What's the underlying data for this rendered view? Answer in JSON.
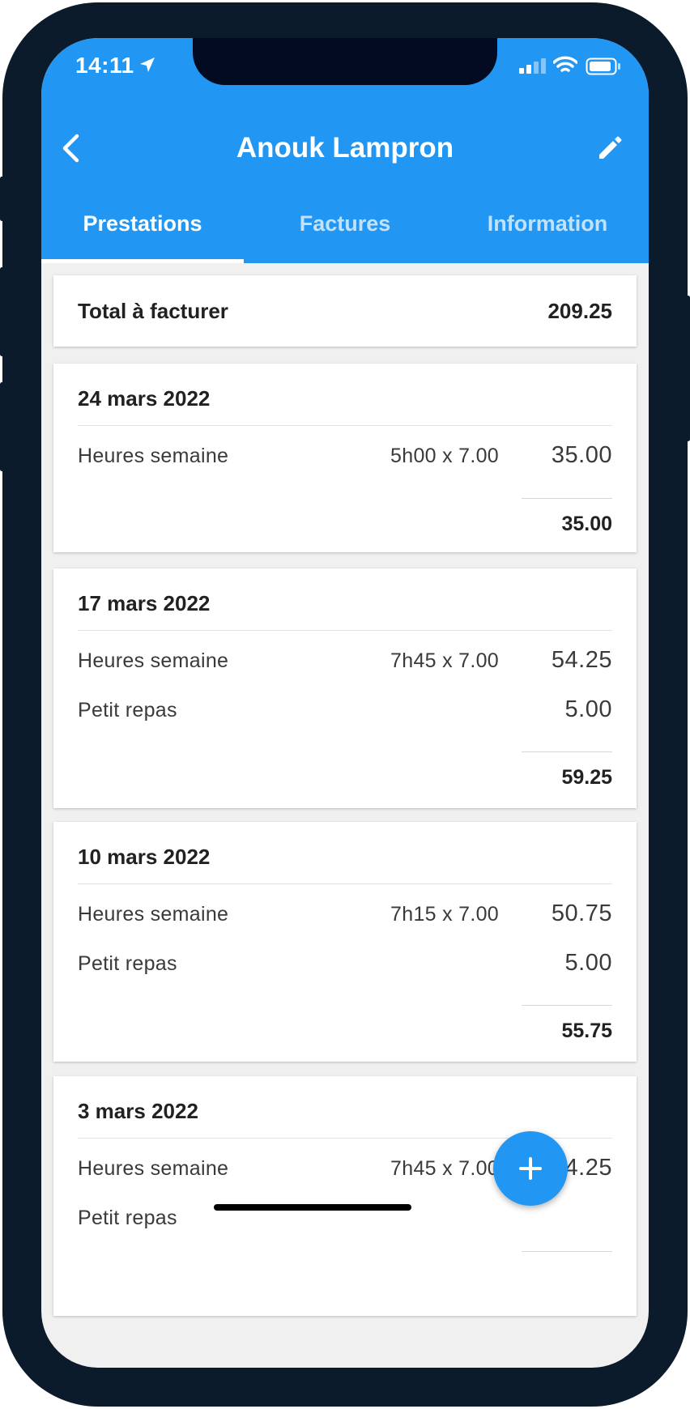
{
  "status_bar": {
    "time": "14:11"
  },
  "header": {
    "title": "Anouk Lampron"
  },
  "tabs": [
    {
      "label": "Prestations",
      "active": true
    },
    {
      "label": "Factures",
      "active": false
    },
    {
      "label": "Information",
      "active": false
    }
  ],
  "summary": {
    "label": "Total à facturer",
    "value": "209.25"
  },
  "entries": [
    {
      "date": "24 mars 2022",
      "lines": [
        {
          "label": "Heures semaine",
          "qty": "5h00 x 7.00",
          "amount": "35.00"
        }
      ],
      "subtotal": "35.00"
    },
    {
      "date": "17 mars 2022",
      "lines": [
        {
          "label": "Heures semaine",
          "qty": "7h45 x 7.00",
          "amount": "54.25"
        },
        {
          "label": "Petit repas",
          "qty": "",
          "amount": "5.00"
        }
      ],
      "subtotal": "59.25"
    },
    {
      "date": "10 mars 2022",
      "lines": [
        {
          "label": "Heures semaine",
          "qty": "7h15 x 7.00",
          "amount": "50.75"
        },
        {
          "label": "Petit repas",
          "qty": "",
          "amount": "5.00"
        }
      ],
      "subtotal": "55.75"
    },
    {
      "date": "3 mars 2022",
      "lines": [
        {
          "label": "Heures semaine",
          "qty": "7h45 x 7.00",
          "amount": "54.25"
        },
        {
          "label": "Petit repas",
          "qty": "",
          "amount": ""
        }
      ],
      "subtotal": ""
    }
  ],
  "colors": {
    "primary": "#2196f3",
    "background": "#f0f0f0",
    "card": "#ffffff"
  },
  "icons": {
    "back": "chevron-left-icon",
    "edit": "pencil-icon",
    "add": "plus-icon",
    "location": "location-arrow-icon",
    "signal": "signal-icon",
    "wifi": "wifi-icon",
    "battery": "battery-icon"
  }
}
